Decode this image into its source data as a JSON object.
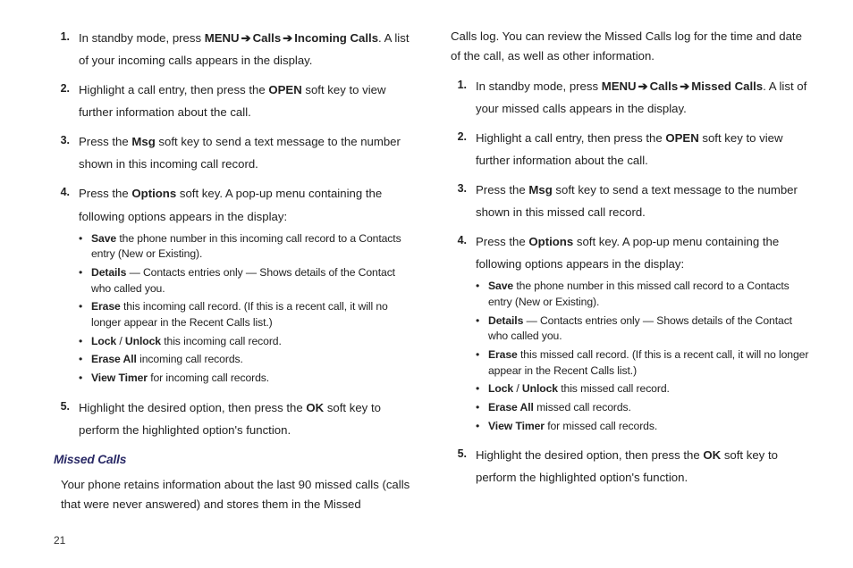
{
  "pageNumber": "21",
  "left": {
    "items": [
      {
        "num": "1.",
        "segments": [
          {
            "t": "In standby mode, press "
          },
          {
            "t": "MENU",
            "b": true
          },
          {
            "t": " ",
            "arrow": true
          },
          {
            "t": "Calls",
            "b": true
          },
          {
            "t": " ",
            "arrow": true
          },
          {
            "t": "Incoming Calls",
            "b": true
          },
          {
            "t": ". A list of your incoming calls appears in the display."
          }
        ]
      },
      {
        "num": "2.",
        "segments": [
          {
            "t": "Highlight a call entry, then press the "
          },
          {
            "t": "OPEN",
            "b": true
          },
          {
            "t": " soft key to view further information about the call."
          }
        ]
      },
      {
        "num": "3.",
        "segments": [
          {
            "t": "Press the "
          },
          {
            "t": "Msg",
            "b": true
          },
          {
            "t": " soft key to send a text message to the number shown in this incoming call record."
          }
        ]
      },
      {
        "num": "4.",
        "segments": [
          {
            "t": "Press the "
          },
          {
            "t": "Options",
            "b": true
          },
          {
            "t": " soft key. A pop-up menu containing the following options appears in the display:"
          }
        ],
        "sub": [
          [
            {
              "t": "Save",
              "b": true
            },
            {
              "t": " the phone number in this incoming call record to a Contacts entry (New or Existing)."
            }
          ],
          [
            {
              "t": "Details",
              "b": true
            },
            {
              "t": " — Contacts entries only — Shows details of the Contact who called you."
            }
          ],
          [
            {
              "t": "Erase",
              "b": true
            },
            {
              "t": " this incoming call record. (If this is a recent call, it will no longer appear in the Recent Calls list.)"
            }
          ],
          [
            {
              "t": "Lock",
              "b": true
            },
            {
              "t": " / "
            },
            {
              "t": "Unlock",
              "b": true
            },
            {
              "t": " this incoming call record."
            }
          ],
          [
            {
              "t": "Erase All",
              "b": true
            },
            {
              "t": " incoming call records."
            }
          ],
          [
            {
              "t": "View Timer",
              "b": true
            },
            {
              "t": " for incoming call records."
            }
          ]
        ]
      },
      {
        "num": "5.",
        "segments": [
          {
            "t": "Highlight the desired option, then press the "
          },
          {
            "t": "OK",
            "b": true
          },
          {
            "t": " soft key to perform the highlighted option's function."
          }
        ]
      }
    ],
    "heading": "Missed Calls",
    "para": "Your phone retains information about the last 90 missed calls (calls that were never answered) and stores them in the Missed"
  },
  "right": {
    "topPara": "Calls log. You can review the Missed Calls log for the time and date of the call, as well as other information.",
    "items": [
      {
        "num": "1.",
        "segments": [
          {
            "t": "In standby mode, press "
          },
          {
            "t": "MENU",
            "b": true
          },
          {
            "t": " ",
            "arrow": true
          },
          {
            "t": "Calls",
            "b": true
          },
          {
            "t": " ",
            "arrow": true
          },
          {
            "t": "Missed Calls",
            "b": true
          },
          {
            "t": ". A list of your missed calls appears in the display."
          }
        ]
      },
      {
        "num": "2.",
        "segments": [
          {
            "t": "Highlight a call entry, then press the "
          },
          {
            "t": "OPEN",
            "b": true
          },
          {
            "t": " soft key to view further information about the call."
          }
        ]
      },
      {
        "num": "3.",
        "segments": [
          {
            "t": "Press the "
          },
          {
            "t": "Msg",
            "b": true
          },
          {
            "t": " soft key to send a text message to the number shown in this missed call record."
          }
        ]
      },
      {
        "num": "4.",
        "segments": [
          {
            "t": "Press the "
          },
          {
            "t": "Options",
            "b": true
          },
          {
            "t": " soft key. A pop-up menu containing the following options appears in the display:"
          }
        ],
        "sub": [
          [
            {
              "t": "Save",
              "b": true
            },
            {
              "t": " the phone number in this missed call record to a Contacts entry (New or Existing)."
            }
          ],
          [
            {
              "t": "Details",
              "b": true
            },
            {
              "t": " — Contacts entries only — Shows details of the Contact who called you."
            }
          ],
          [
            {
              "t": "Erase",
              "b": true
            },
            {
              "t": " this missed call record. (If this is a recent call, it will no longer appear in the Recent Calls list.)"
            }
          ],
          [
            {
              "t": "Lock",
              "b": true
            },
            {
              "t": " / "
            },
            {
              "t": "Unlock",
              "b": true
            },
            {
              "t": " this missed call record."
            }
          ],
          [
            {
              "t": "Erase All",
              "b": true
            },
            {
              "t": " missed call records."
            }
          ],
          [
            {
              "t": "View Timer",
              "b": true
            },
            {
              "t": " for missed call records."
            }
          ]
        ]
      },
      {
        "num": "5.",
        "segments": [
          {
            "t": "Highlight the desired option, then press the "
          },
          {
            "t": "OK",
            "b": true
          },
          {
            "t": " soft key to perform the highlighted option's function."
          }
        ]
      }
    ]
  }
}
